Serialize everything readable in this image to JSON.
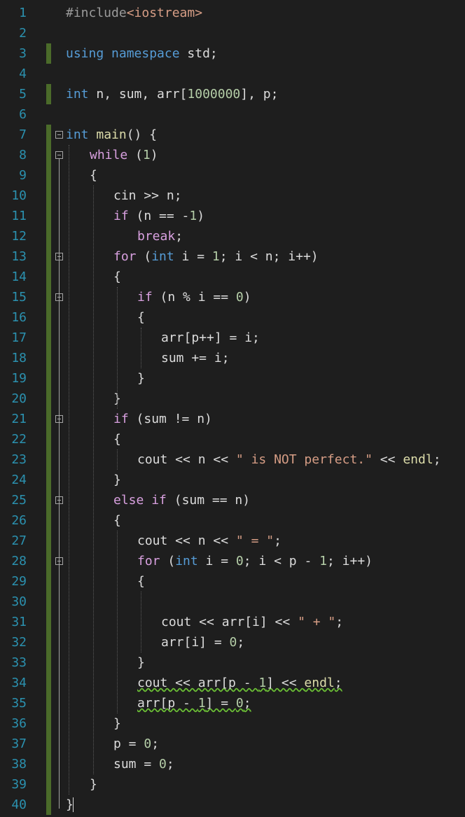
{
  "colors": {
    "background": "#1e1e1e",
    "line_number": "#2b91af",
    "preprocessor": "#9b9b9b",
    "keyword": "#569cd6",
    "control": "#d8a0df",
    "string": "#d69d85",
    "number": "#b5cea8",
    "default": "#dcdcdc",
    "function": "#dcdcaa",
    "change_bar": "#4b6b2a"
  },
  "lines": [
    {
      "n": "1",
      "indent": 0,
      "tokens": [
        {
          "t": "#include",
          "c": "preprocessor"
        },
        {
          "t": "<iostream>",
          "c": "string"
        }
      ]
    },
    {
      "n": "2",
      "indent": 0,
      "tokens": []
    },
    {
      "n": "3",
      "indent": 0,
      "tokens": [
        {
          "t": "using",
          "c": "keyword"
        },
        {
          "t": " ",
          "c": "default"
        },
        {
          "t": "namespace",
          "c": "keyword"
        },
        {
          "t": " std;",
          "c": "default"
        }
      ]
    },
    {
      "n": "4",
      "indent": 0,
      "tokens": []
    },
    {
      "n": "5",
      "indent": 0,
      "tokens": [
        {
          "t": "int",
          "c": "keyword"
        },
        {
          "t": " n, sum, arr[",
          "c": "default"
        },
        {
          "t": "1000000",
          "c": "number"
        },
        {
          "t": "], p;",
          "c": "default"
        }
      ]
    },
    {
      "n": "6",
      "indent": 0,
      "tokens": []
    },
    {
      "n": "7",
      "indent": 0,
      "tokens": [
        {
          "t": "int",
          "c": "keyword"
        },
        {
          "t": " ",
          "c": "default"
        },
        {
          "t": "main",
          "c": "function"
        },
        {
          "t": "() {",
          "c": "default"
        }
      ]
    },
    {
      "n": "8",
      "indent": 1,
      "tokens": [
        {
          "t": "while",
          "c": "control"
        },
        {
          "t": " (",
          "c": "default"
        },
        {
          "t": "1",
          "c": "number"
        },
        {
          "t": ")",
          "c": "default"
        }
      ]
    },
    {
      "n": "9",
      "indent": 1,
      "tokens": [
        {
          "t": "{",
          "c": "default"
        }
      ]
    },
    {
      "n": "10",
      "indent": 2,
      "tokens": [
        {
          "t": "cin >> n;",
          "c": "default"
        }
      ]
    },
    {
      "n": "11",
      "indent": 2,
      "tokens": [
        {
          "t": "if",
          "c": "control"
        },
        {
          "t": " (n == -",
          "c": "default"
        },
        {
          "t": "1",
          "c": "number"
        },
        {
          "t": ")",
          "c": "default"
        }
      ]
    },
    {
      "n": "12",
      "indent": 3,
      "tokens": [
        {
          "t": "break",
          "c": "control"
        },
        {
          "t": ";",
          "c": "default"
        }
      ]
    },
    {
      "n": "13",
      "indent": 2,
      "tokens": [
        {
          "t": "for",
          "c": "control"
        },
        {
          "t": " (",
          "c": "default"
        },
        {
          "t": "int",
          "c": "keyword"
        },
        {
          "t": " i = ",
          "c": "default"
        },
        {
          "t": "1",
          "c": "number"
        },
        {
          "t": "; i < n; i++)",
          "c": "default"
        }
      ]
    },
    {
      "n": "14",
      "indent": 2,
      "tokens": [
        {
          "t": "{",
          "c": "default"
        }
      ]
    },
    {
      "n": "15",
      "indent": 3,
      "tokens": [
        {
          "t": "if",
          "c": "control"
        },
        {
          "t": " (n % i == ",
          "c": "default"
        },
        {
          "t": "0",
          "c": "number"
        },
        {
          "t": ")",
          "c": "default"
        }
      ]
    },
    {
      "n": "16",
      "indent": 3,
      "tokens": [
        {
          "t": "{",
          "c": "default"
        }
      ]
    },
    {
      "n": "17",
      "indent": 4,
      "tokens": [
        {
          "t": "arr[p++] = i;",
          "c": "default"
        }
      ]
    },
    {
      "n": "18",
      "indent": 4,
      "tokens": [
        {
          "t": "sum += i;",
          "c": "default"
        }
      ]
    },
    {
      "n": "19",
      "indent": 3,
      "tokens": [
        {
          "t": "}",
          "c": "default"
        }
      ]
    },
    {
      "n": "20",
      "indent": 2,
      "tokens": [
        {
          "t": "}",
          "c": "default"
        }
      ]
    },
    {
      "n": "21",
      "indent": 2,
      "tokens": [
        {
          "t": "if",
          "c": "control"
        },
        {
          "t": " (sum != n)",
          "c": "default"
        }
      ]
    },
    {
      "n": "22",
      "indent": 2,
      "tokens": [
        {
          "t": "{",
          "c": "default"
        }
      ]
    },
    {
      "n": "23",
      "indent": 3,
      "tokens": [
        {
          "t": "cout << n << ",
          "c": "default"
        },
        {
          "t": "\" is NOT perfect.\"",
          "c": "string"
        },
        {
          "t": " << ",
          "c": "default"
        },
        {
          "t": "endl",
          "c": "function"
        },
        {
          "t": ";",
          "c": "default"
        }
      ]
    },
    {
      "n": "24",
      "indent": 2,
      "tokens": [
        {
          "t": "}",
          "c": "default"
        }
      ]
    },
    {
      "n": "25",
      "indent": 2,
      "tokens": [
        {
          "t": "else",
          "c": "control"
        },
        {
          "t": " ",
          "c": "default"
        },
        {
          "t": "if",
          "c": "control"
        },
        {
          "t": " (sum == n)",
          "c": "default"
        }
      ]
    },
    {
      "n": "26",
      "indent": 2,
      "tokens": [
        {
          "t": "{",
          "c": "default"
        }
      ]
    },
    {
      "n": "27",
      "indent": 3,
      "tokens": [
        {
          "t": "cout << n << ",
          "c": "default"
        },
        {
          "t": "\" = \"",
          "c": "string"
        },
        {
          "t": ";",
          "c": "default"
        }
      ]
    },
    {
      "n": "28",
      "indent": 3,
      "tokens": [
        {
          "t": "for",
          "c": "control"
        },
        {
          "t": " (",
          "c": "default"
        },
        {
          "t": "int",
          "c": "keyword"
        },
        {
          "t": " i = ",
          "c": "default"
        },
        {
          "t": "0",
          "c": "number"
        },
        {
          "t": "; i < p - ",
          "c": "default"
        },
        {
          "t": "1",
          "c": "number"
        },
        {
          "t": "; i++)",
          "c": "default"
        }
      ]
    },
    {
      "n": "29",
      "indent": 3,
      "tokens": [
        {
          "t": "{",
          "c": "default"
        }
      ]
    },
    {
      "n": "30",
      "indent": 4,
      "tokens": []
    },
    {
      "n": "31",
      "indent": 4,
      "tokens": [
        {
          "t": "cout << arr[i] << ",
          "c": "default"
        },
        {
          "t": "\" + \"",
          "c": "string"
        },
        {
          "t": ";",
          "c": "default"
        }
      ]
    },
    {
      "n": "32",
      "indent": 4,
      "tokens": [
        {
          "t": "arr[i] = ",
          "c": "default"
        },
        {
          "t": "0",
          "c": "number"
        },
        {
          "t": ";",
          "c": "default"
        }
      ]
    },
    {
      "n": "33",
      "indent": 3,
      "tokens": [
        {
          "t": "}",
          "c": "default"
        }
      ]
    },
    {
      "n": "34",
      "indent": 3,
      "squiggle": true,
      "tokens": [
        {
          "t": "cout << arr[p - ",
          "c": "default"
        },
        {
          "t": "1",
          "c": "number"
        },
        {
          "t": "] << ",
          "c": "default"
        },
        {
          "t": "endl",
          "c": "function"
        },
        {
          "t": ";",
          "c": "default"
        }
      ]
    },
    {
      "n": "35",
      "indent": 3,
      "squiggle": true,
      "tokens": [
        {
          "t": "arr[p - ",
          "c": "default"
        },
        {
          "t": "1",
          "c": "number"
        },
        {
          "t": "] = ",
          "c": "default"
        },
        {
          "t": "0",
          "c": "number"
        },
        {
          "t": ";",
          "c": "default"
        }
      ]
    },
    {
      "n": "36",
      "indent": 2,
      "tokens": [
        {
          "t": "}",
          "c": "default"
        }
      ]
    },
    {
      "n": "37",
      "indent": 2,
      "tokens": [
        {
          "t": "p = ",
          "c": "default"
        },
        {
          "t": "0",
          "c": "number"
        },
        {
          "t": ";",
          "c": "default"
        }
      ]
    },
    {
      "n": "38",
      "indent": 2,
      "tokens": [
        {
          "t": "sum = ",
          "c": "default"
        },
        {
          "t": "0",
          "c": "number"
        },
        {
          "t": ";",
          "c": "default"
        }
      ]
    },
    {
      "n": "39",
      "indent": 1,
      "tokens": [
        {
          "t": "}",
          "c": "default"
        }
      ]
    },
    {
      "n": "40",
      "indent": 0,
      "tokens": [
        {
          "t": "}",
          "c": "default"
        }
      ]
    }
  ]
}
